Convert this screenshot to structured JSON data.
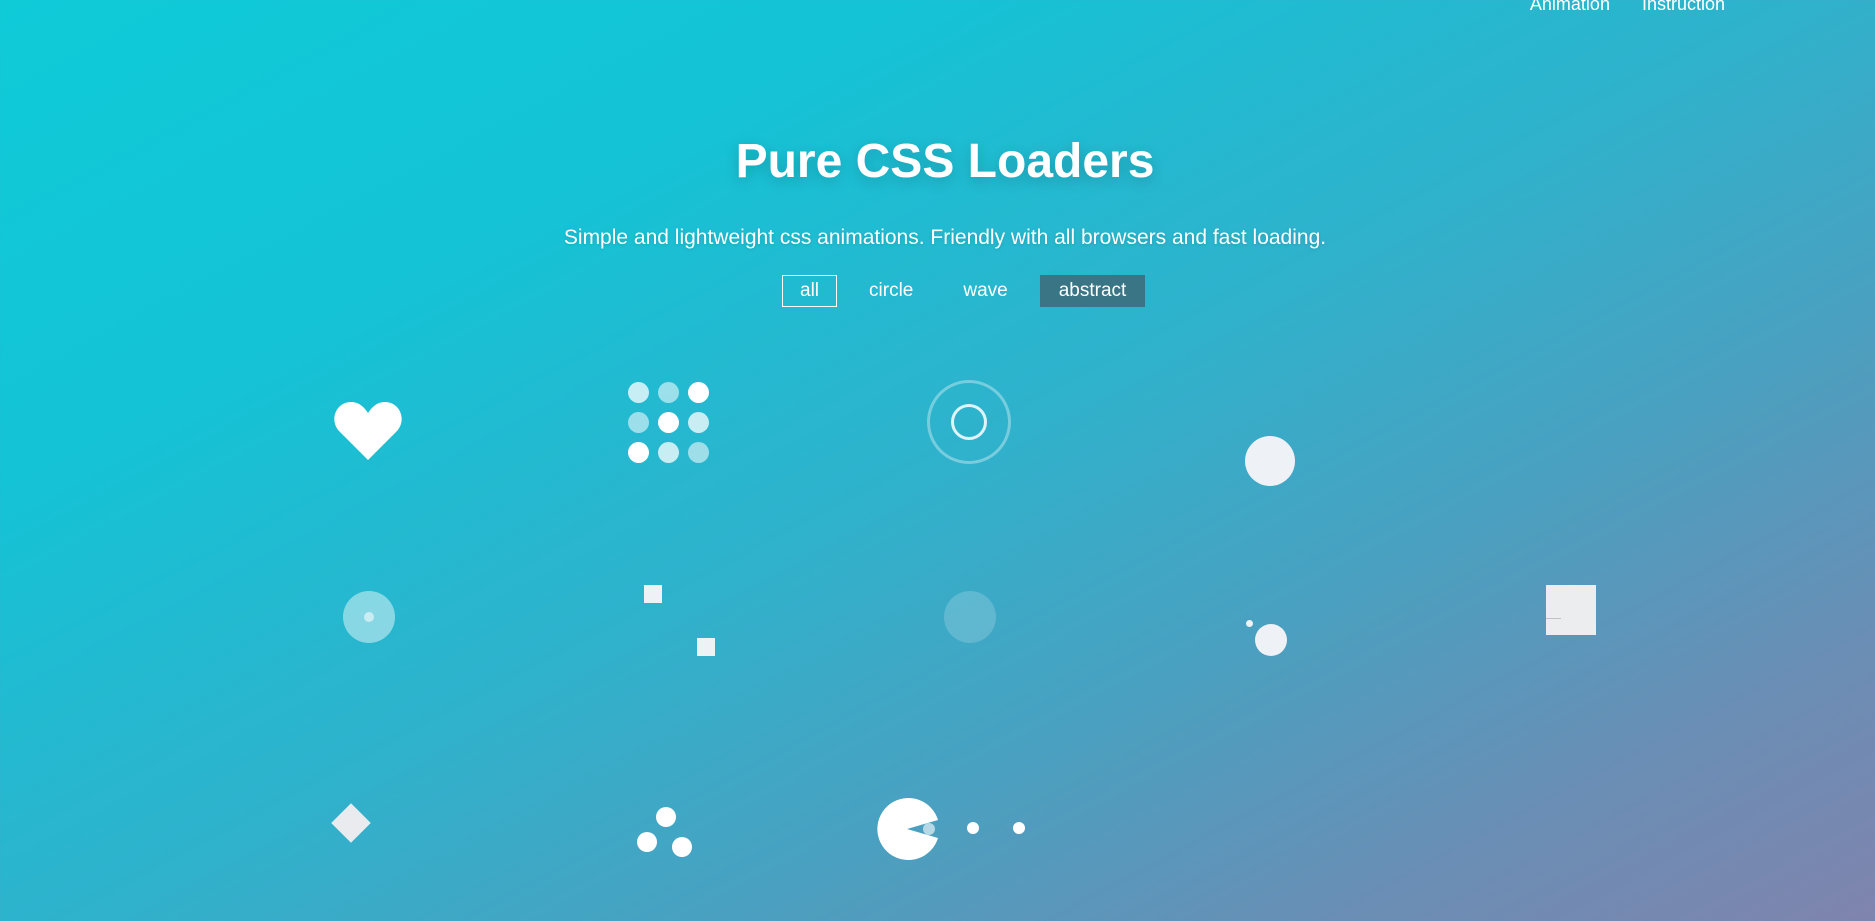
{
  "nav": {
    "links": [
      {
        "label": "Animation"
      },
      {
        "label": "Instruction"
      }
    ]
  },
  "hero": {
    "title": "Pure CSS Loaders",
    "subtitle": "Simple and lightweight css animations. Friendly with all browsers and fast loading."
  },
  "filters": [
    {
      "label": "all",
      "state": "outlined"
    },
    {
      "label": "circle",
      "state": "normal"
    },
    {
      "label": "wave",
      "state": "normal"
    },
    {
      "label": "abstract",
      "state": "selected"
    }
  ],
  "colors": {
    "gradient_start": "#0fcbd8",
    "gradient_end": "#7f84ad",
    "selected_filter_bg": "#3a7585",
    "loader_fill": "#eef1f5"
  },
  "loaders": [
    {
      "icon": "heart-loader-icon"
    },
    {
      "icon": "dot-grid-loader-icon"
    },
    {
      "icon": "target-ring-loader-icon"
    },
    {
      "icon": "bouncing-dot-loader-icon"
    },
    {
      "icon": "pulse-circle-loader-icon"
    },
    {
      "icon": "moving-squares-loader-icon"
    },
    {
      "icon": "fading-circle-loader-icon"
    },
    {
      "icon": "orbit-dots-loader-icon"
    },
    {
      "icon": "folding-box-loader-icon"
    },
    {
      "icon": "diamond-loader-icon"
    },
    {
      "icon": "triple-dots-loader-icon"
    },
    {
      "icon": "pacman-loader-icon"
    }
  ]
}
